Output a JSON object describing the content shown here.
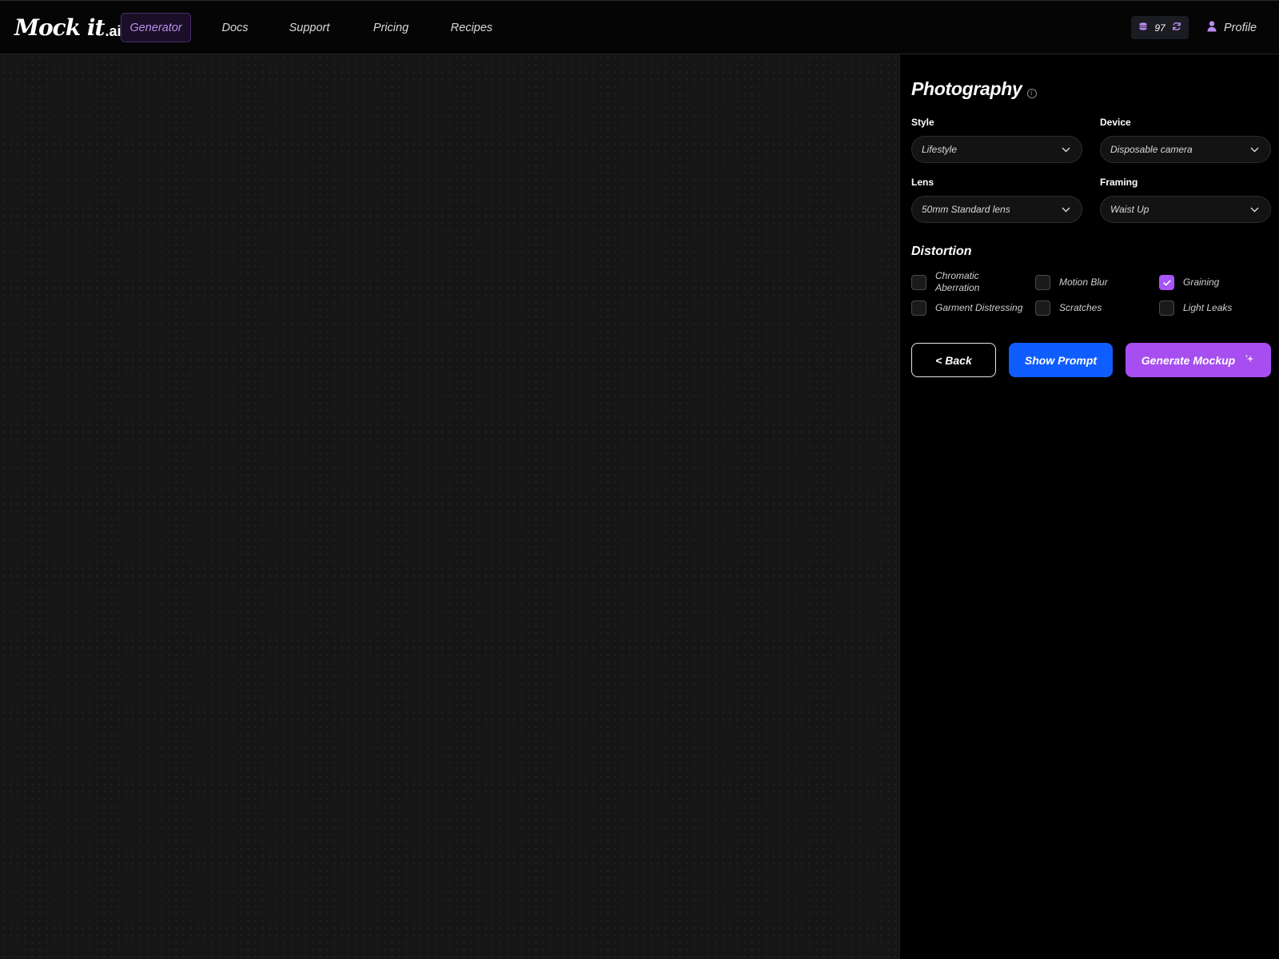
{
  "app": {
    "logo_script": "Mock it",
    "logo_suffix": ".ai"
  },
  "nav": {
    "items": [
      {
        "label": "Generator",
        "active": true
      },
      {
        "label": "Docs",
        "active": false
      },
      {
        "label": "Support",
        "active": false
      },
      {
        "label": "Pricing",
        "active": false
      },
      {
        "label": "Recipes",
        "active": false
      }
    ]
  },
  "header": {
    "credits": "97",
    "credits_icon": "coins-icon",
    "refresh_icon": "refresh-icon",
    "profile_label": "Profile",
    "profile_icon": "user-icon"
  },
  "panel": {
    "title": "Photography",
    "info_glyph": "i",
    "fields": {
      "style": {
        "label": "Style",
        "value": "Lifestyle"
      },
      "device": {
        "label": "Device",
        "value": "Disposable camera"
      },
      "lens": {
        "label": "Lens",
        "value": "50mm Standard lens"
      },
      "framing": {
        "label": "Framing",
        "value": "Waist Up"
      }
    },
    "distortion": {
      "title": "Distortion",
      "options": [
        {
          "label": "Chromatic Aberration",
          "checked": false
        },
        {
          "label": "Motion Blur",
          "checked": false
        },
        {
          "label": "Graining",
          "checked": true
        },
        {
          "label": "Garment Distressing",
          "checked": false
        },
        {
          "label": "Scratches",
          "checked": false
        },
        {
          "label": "Light Leaks",
          "checked": false
        }
      ]
    },
    "buttons": {
      "back": "< Back",
      "show_prompt": "Show Prompt",
      "generate": "Generate Mockup"
    }
  },
  "colors": {
    "accent_purple": "#a855f7",
    "primary_blue": "#0f5cff",
    "background": "#000000"
  }
}
